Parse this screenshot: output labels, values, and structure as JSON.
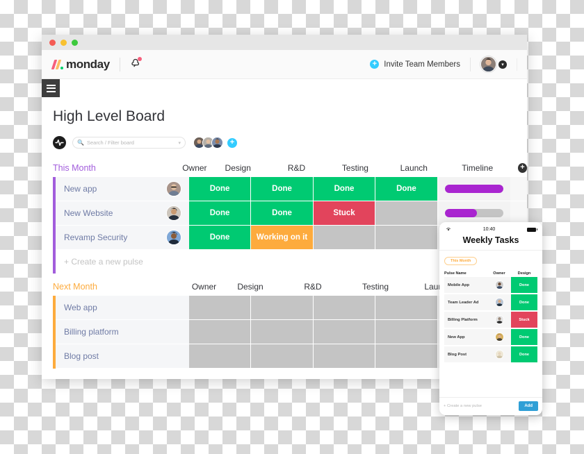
{
  "window": {
    "traffic_lights": [
      "red",
      "yellow",
      "green"
    ]
  },
  "topbar": {
    "logo_text": "monday",
    "notifications_icon": "bell-icon",
    "invite_label": "Invite Team Members",
    "invite_icon": "plus-circle-icon",
    "user_menu_icon": "chevron-down-icon"
  },
  "menu": {
    "hamburger_icon": "hamburger-menu-icon"
  },
  "board": {
    "title": "High Level Board",
    "pulse_icon": "pulse-logo-icon",
    "search": {
      "placeholder": "Search / Filter board",
      "value": "",
      "icon": "search-icon",
      "caret_icon": "chevron-down-icon"
    },
    "add_member_label": "+",
    "add_column_label": "+",
    "create_pulse_label": "+ Create a new pulse"
  },
  "columns": {
    "owner": "Owner",
    "design": "Design",
    "rd": "R&D",
    "testing": "Testing",
    "launch": "Launch",
    "timeline": "Timeline"
  },
  "groups": [
    {
      "name": "This Month",
      "color": "#a25ddc",
      "rows": [
        {
          "name": "New app",
          "design": "Done",
          "rd": "Done",
          "testing": "Done",
          "launch": "Done",
          "timeline_pct": 100
        },
        {
          "name": "New Website",
          "design": "Done",
          "rd": "Done",
          "testing": "Stuck",
          "launch": "",
          "timeline_pct": 55
        },
        {
          "name": "Revamp Security",
          "design": "Done",
          "rd": "Working on it",
          "testing": "",
          "launch": "",
          "timeline_pct": 0
        }
      ]
    },
    {
      "name": "Next Month",
      "color": "#fdab3d",
      "rows": [
        {
          "name": "Web app",
          "design": "",
          "rd": "",
          "testing": "",
          "launch": ""
        },
        {
          "name": "Billing platform",
          "design": "",
          "rd": "",
          "testing": "",
          "launch": ""
        },
        {
          "name": "Blog post",
          "design": "",
          "rd": "",
          "testing": "",
          "launch": ""
        }
      ]
    }
  ],
  "status_colors": {
    "Done": "#00ca72",
    "Stuck": "#e2445c",
    "Working on it": "#fdab3d",
    "empty": "#c4c4c4"
  },
  "phone": {
    "status_bar": {
      "time": "10:40",
      "wifi_icon": "wifi-icon",
      "battery_icon": "battery-icon"
    },
    "title": "Weekly Tasks",
    "group_pill": "This Month",
    "columns": {
      "name": "Pulse Name",
      "owner": "Owner",
      "design": "Design"
    },
    "rows": [
      {
        "name": "Mobile App",
        "design": "Done"
      },
      {
        "name": "Team Leader Ad",
        "design": "Done"
      },
      {
        "name": "Billing Platform",
        "design": "Stuck"
      },
      {
        "name": "New App",
        "design": "Done"
      },
      {
        "name": "Blog Post",
        "design": "Done"
      }
    ],
    "create_label": "+ Create a new pulse",
    "add_label": "Add"
  }
}
